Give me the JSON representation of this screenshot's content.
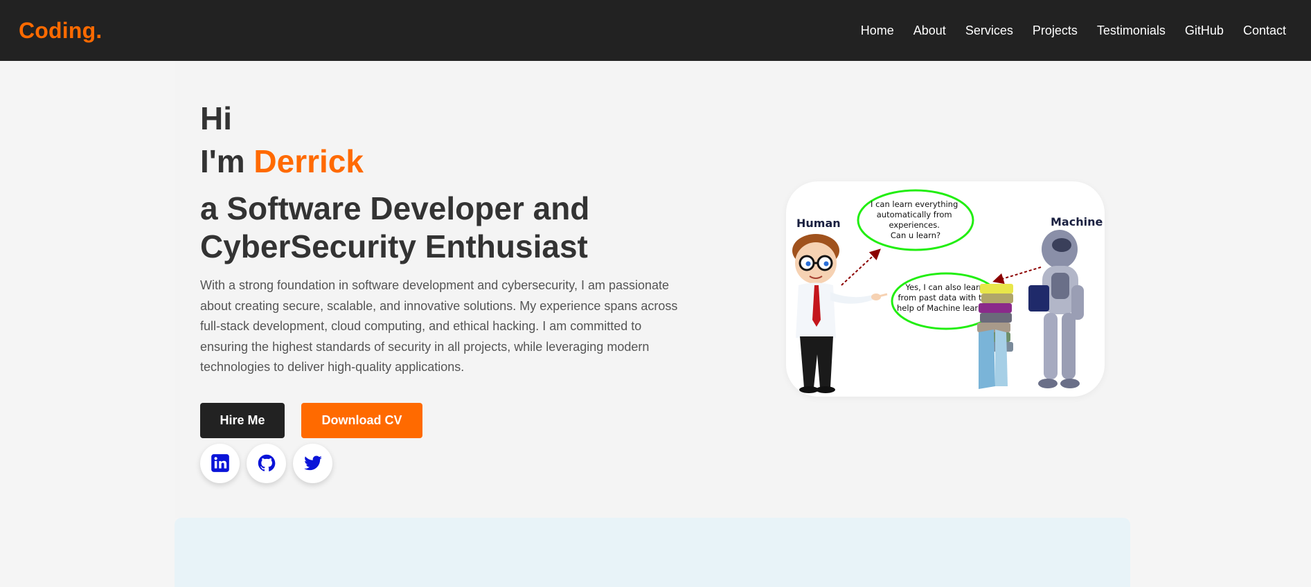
{
  "nav": {
    "logo": "Coding.",
    "links": [
      "Home",
      "About",
      "Services",
      "Projects",
      "Testimonials",
      "GitHub",
      "Contact"
    ]
  },
  "hero": {
    "greeting": "Hi",
    "intro_prefix": "I'm ",
    "name": "Derrick",
    "role_line1": "a Software Developer and",
    "role_line2": "CyberSecurity Enthusiast",
    "description": "With a strong foundation in software development and cybersecurity, I am passionate about creating secure, scalable, and innovative solutions. My experience spans across full-stack development, cloud computing, and ethical hacking. I am committed to ensuring the highest standards of security in all projects, while leveraging modern technologies to deliver high-quality applications.",
    "buttons": {
      "hire": "Hire Me",
      "cv": "Download CV"
    },
    "socials": [
      "linkedin-icon",
      "github-icon",
      "twitter-icon"
    ]
  },
  "illustration": {
    "human_label": "Human",
    "machine_label": "Machine",
    "bubble1": [
      "I can learn everything",
      "automatically  from",
      "experiences.",
      "Can u learn?"
    ],
    "bubble2": [
      "Yes, I can also learn",
      "from past data with the",
      "help of Machine learning"
    ]
  },
  "colors": {
    "accent": "#ff6a00",
    "navbar": "#222222",
    "icon": "#0a14d8",
    "bubble": "#22ee11"
  }
}
